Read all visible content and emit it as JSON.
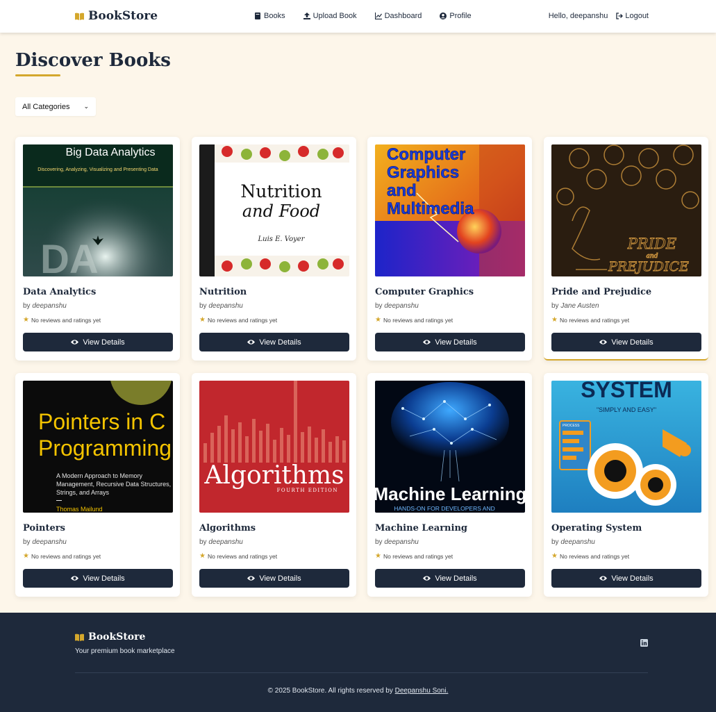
{
  "header": {
    "brand": "BookStore",
    "nav": [
      {
        "label": "Books",
        "icon": "book-icon"
      },
      {
        "label": "Upload Book",
        "icon": "upload-icon"
      },
      {
        "label": "Dashboard",
        "icon": "chart-line-icon"
      },
      {
        "label": "Profile",
        "icon": "user-circle-icon"
      }
    ],
    "greeting": "Hello, deepanshu",
    "logout": "Logout"
  },
  "main": {
    "title": "Discover Books",
    "category_select": {
      "selected": "All Categories"
    },
    "books": [
      {
        "title": "Data Analytics",
        "by": "by",
        "author": "deepanshu",
        "rating_text": "No reviews and ratings yet",
        "button": "View Details",
        "cover": {
          "heading": "Big Data Analytics",
          "sub": "Discovering, Analyzing, Visualizing and Presenting Data",
          "big": "DA"
        }
      },
      {
        "title": "Nutrition",
        "by": "by",
        "author": "deepanshu",
        "rating_text": "No reviews and ratings yet",
        "button": "View Details",
        "cover": {
          "line1": "Nutrition",
          "line2": "and Food",
          "author": "Luis E. Voyer"
        }
      },
      {
        "title": "Computer Graphics",
        "by": "by",
        "author": "deepanshu",
        "rating_text": "No reviews and ratings yet",
        "button": "View Details",
        "cover": {
          "line1": "Computer",
          "line2": "Graphics",
          "line3": "and",
          "line4": "Multimedia"
        }
      },
      {
        "title": "Pride and Prejudice",
        "by": "by",
        "author": "Jane Austen",
        "rating_text": "No reviews and ratings yet",
        "button": "View Details",
        "cover": {
          "line1": "PRIDE",
          "line2": "and",
          "line3": "PREJUDICE"
        }
      },
      {
        "title": "Pointers",
        "by": "by",
        "author": "deepanshu",
        "rating_text": "No reviews and ratings yet",
        "button": "View Details",
        "cover": {
          "line1": "Pointers in C",
          "line2": "Programming",
          "sub1": "A Modern Approach to Memory",
          "sub2": "Management, Recursive Data Structures,",
          "sub3": "Strings, and Arrays",
          "author": "Thomas Mailund"
        }
      },
      {
        "title": "Algorithms",
        "by": "by",
        "author": "deepanshu",
        "rating_text": "No reviews and ratings yet",
        "button": "View Details",
        "cover": {
          "line1": "Algorithms",
          "edition": "FOURTH EDITION"
        }
      },
      {
        "title": "Machine Learning",
        "by": "by",
        "author": "deepanshu",
        "rating_text": "No reviews and ratings yet",
        "button": "View Details",
        "cover": {
          "line1": "Machine Learning",
          "sub": "HANDS-ON FOR DEVELOPERS AND"
        }
      },
      {
        "title": "Operating System",
        "by": "by",
        "author": "deepanshu",
        "rating_text": "No reviews and ratings yet",
        "button": "View Details",
        "cover": {
          "line1": "SYSTEM",
          "sub": "\"SIMPLY AND EASY\"",
          "tag": "PROCESS"
        }
      }
    ]
  },
  "footer": {
    "brand": "BookStore",
    "tagline": "Your premium book marketplace",
    "copyright_prefix": "© 2025 BookStore. All rights reserved by ",
    "copyright_link": "Deepanshu Soni."
  },
  "colors": {
    "accent": "#d4a72c",
    "dark": "#1e293b",
    "background": "#fdf6ea"
  }
}
